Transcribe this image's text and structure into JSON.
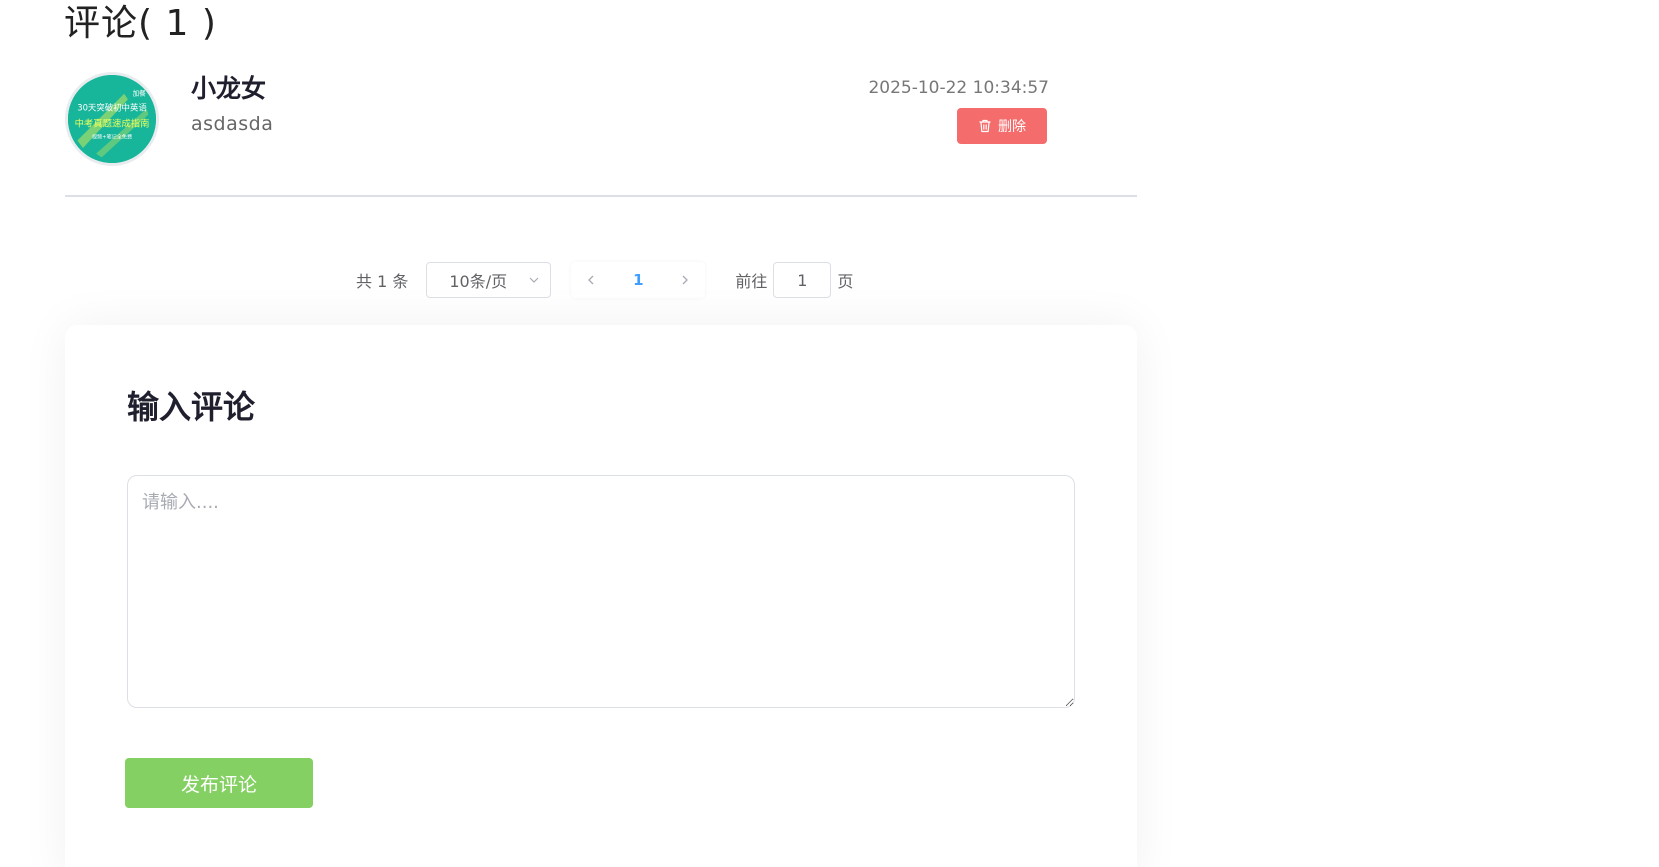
{
  "section": {
    "title": "评论( 1 )"
  },
  "comments": [
    {
      "avatar": {
        "line1": "30天突破初中英语",
        "line2": "中考真题速成指南",
        "line3": "视频+笔记全免费",
        "corner": "加餐"
      },
      "name": "小龙女",
      "text": "asdasda",
      "time": "2025-10-22 10:34:57",
      "delete_label": "删除"
    }
  ],
  "pagination": {
    "total_text": "共 1 条",
    "page_size": "10条/页",
    "current_page": "1",
    "goto_prefix": "前往",
    "goto_value": "1",
    "goto_suffix": "页"
  },
  "input_card": {
    "title": "输入评论",
    "placeholder": "请输入....",
    "submit_label": "发布评论"
  },
  "colors": {
    "delete_button": "#f56c6c",
    "submit_button": "#84d063",
    "active_page": "#409eff",
    "avatar_bg": "#17b59a"
  },
  "icons": {
    "delete": "trash-icon",
    "page_size_dropdown": "chevron-down-icon",
    "prev_page": "chevron-left-icon",
    "next_page": "chevron-right-icon"
  }
}
